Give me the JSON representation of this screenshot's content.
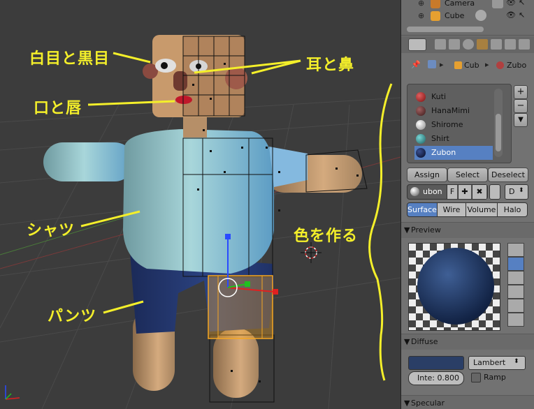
{
  "annotations": {
    "eyes": "白目と黒目",
    "ears_nose": "耳と鼻",
    "mouth_lips": "口と唇",
    "shirt": "シャツ",
    "pants": "パンツ",
    "make_color": "色を作る"
  },
  "outliner": {
    "items": [
      {
        "label": "Camera",
        "icon": "camera-icon"
      },
      {
        "label": "Cube",
        "icon": "mesh-icon"
      }
    ]
  },
  "properties": {
    "breadcrumb": {
      "object": "Cub",
      "material": "Zubo"
    },
    "materials": [
      {
        "name": "Kuti",
        "color": "#7a1010"
      },
      {
        "name": "HanaMimi",
        "color": "#5a2a2a"
      },
      {
        "name": "Shirome",
        "color": "#d8d8d8"
      },
      {
        "name": "Shirt",
        "color": "#2a8f8f"
      },
      {
        "name": "Zubon",
        "color": "#0d1a40"
      }
    ],
    "selected_material": "Zubon",
    "actions": {
      "assign": "Assign",
      "select": "Select",
      "deselect": "Deselect"
    },
    "material_field": {
      "name": "ubon",
      "fake_user": "F",
      "browse": "D"
    },
    "tabs": [
      "Surface",
      "Wire",
      "Volume",
      "Halo"
    ],
    "active_tab": "Surface",
    "preview": {
      "title": "Preview"
    },
    "diffuse": {
      "title": "Diffuse",
      "color": "#2a3e66",
      "shader": "Lambert",
      "intensity": "Inte: 0.800",
      "ramp_label": "Ramp"
    },
    "specular": {
      "title": "Specular"
    }
  },
  "viewport": {
    "accent": "#f4ef2a",
    "selection": "#f5a623"
  }
}
